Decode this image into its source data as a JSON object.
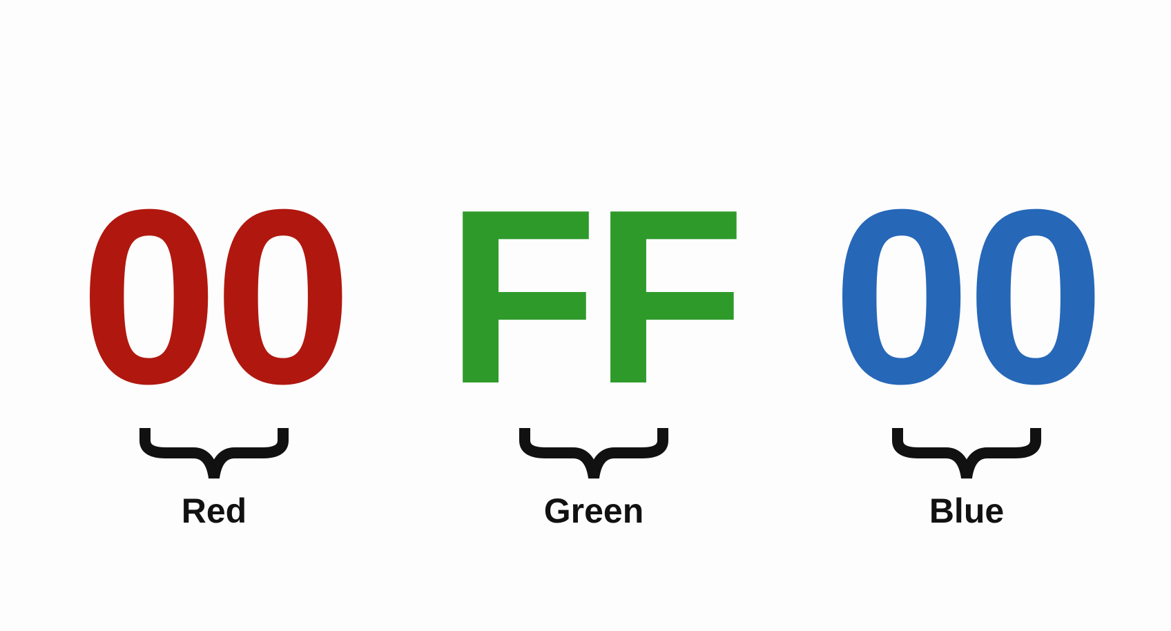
{
  "channels": [
    {
      "value": "00",
      "label": "Red",
      "color": "#b0180f"
    },
    {
      "value": "FF",
      "label": "Green",
      "color": "#2e9a2a"
    },
    {
      "value": "00",
      "label": "Blue",
      "color": "#2667b8"
    }
  ],
  "icons": {
    "brace": "curly-brace-down-icon"
  },
  "brace_color": "#111111"
}
